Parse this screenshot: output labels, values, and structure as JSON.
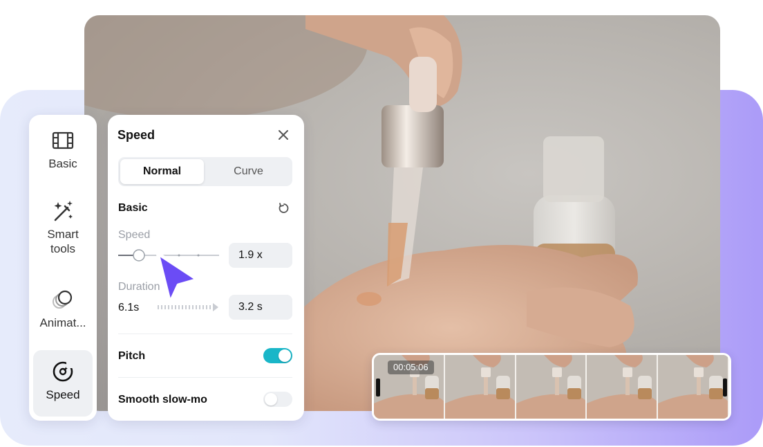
{
  "sidebar": {
    "items": [
      {
        "label": "Basic",
        "icon": "film-icon"
      },
      {
        "label": "Smart\ntools",
        "icon": "magic-wand-icon"
      },
      {
        "label": "Animat...",
        "icon": "animation-circles-icon"
      },
      {
        "label": "Speed",
        "icon": "speedometer-icon",
        "active": true
      }
    ]
  },
  "panel": {
    "title": "Speed",
    "tabs": [
      {
        "label": "Normal",
        "active": true
      },
      {
        "label": "Curve",
        "active": false
      }
    ],
    "basic_label": "Basic",
    "speed_label": "Speed",
    "speed_value": "1.9 x",
    "speed_slider_fraction": 0.18,
    "duration_label": "Duration",
    "duration_original": "6.1s",
    "duration_value": "3.2 s",
    "pitch_label": "Pitch",
    "pitch_on": true,
    "smooth_label": "Smooth slow-mo",
    "smooth_on": false
  },
  "timeline": {
    "timecode": "00:05:06",
    "frame_count": 5
  },
  "colors": {
    "accent_toggle": "#19b6c8",
    "cursor": "#6b4cf5",
    "sidebar_active_bg": "#eef0f3"
  }
}
